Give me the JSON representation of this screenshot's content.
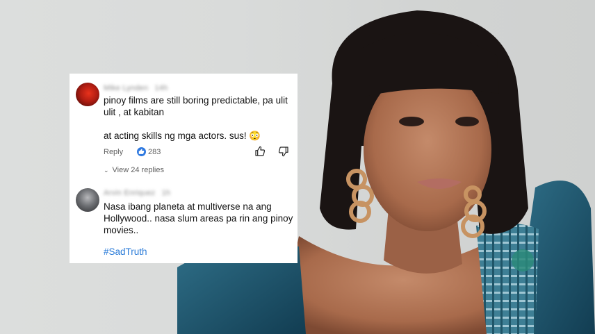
{
  "comments": [
    {
      "author": "Mike Lynden",
      "time": "14h",
      "text": "pinoy films are still boring predictable, pa ulit\nulit , at kabitan\n\nat acting skills ng mga actors. sus! 😳",
      "actions": {
        "reply": "Reply",
        "likes": "283"
      },
      "view_replies": "View 24 replies"
    },
    {
      "author": "Arvin Enriquez",
      "time": "1h",
      "text": "Nasa ibang planeta at multiverse na ang\nHollywood.. nasa slum areas pa rin ang pinoy\nmovies..",
      "hashtag": "#SadTruth"
    }
  ],
  "icons": [
    "thumbs-up-icon",
    "thumbs-down-icon",
    "chevron-down-icon",
    "like-badge-icon"
  ],
  "colors": {
    "hashtag": "#2a7bd8",
    "like_badge": "#2f79e0",
    "text": "#111111"
  }
}
